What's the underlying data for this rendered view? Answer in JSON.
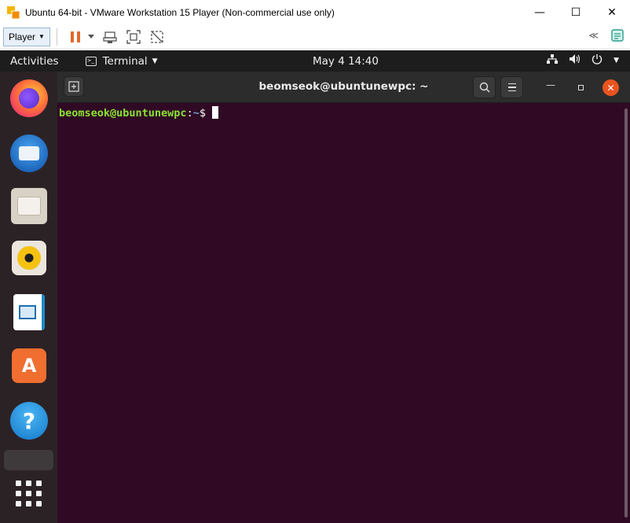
{
  "window": {
    "title": "Ubuntu 64-bit - VMware Workstation 15 Player (Non-commercial use only)",
    "minimize_glyph": "—",
    "maximize_glyph": "☐",
    "close_glyph": "✕"
  },
  "toolbar": {
    "player_label": "Player",
    "collapse_glyph": "≪"
  },
  "topbar": {
    "activities": "Activities",
    "app_menu": "Terminal",
    "clock": "May 4  14:40"
  },
  "terminal": {
    "title": "beomseok@ubuntunewpc: ~",
    "prompt_user": "beomseok@ubuntunewpc",
    "prompt_sep": ":",
    "prompt_path": "~",
    "prompt_symbol": "$"
  },
  "dock": {
    "help_glyph": "?",
    "software_glyph": "A"
  },
  "colors": {
    "terminal_bg": "#300a24",
    "prompt_green": "#8ae234",
    "prompt_blue": "#729fcf",
    "ubuntu_orange": "#e95420"
  }
}
